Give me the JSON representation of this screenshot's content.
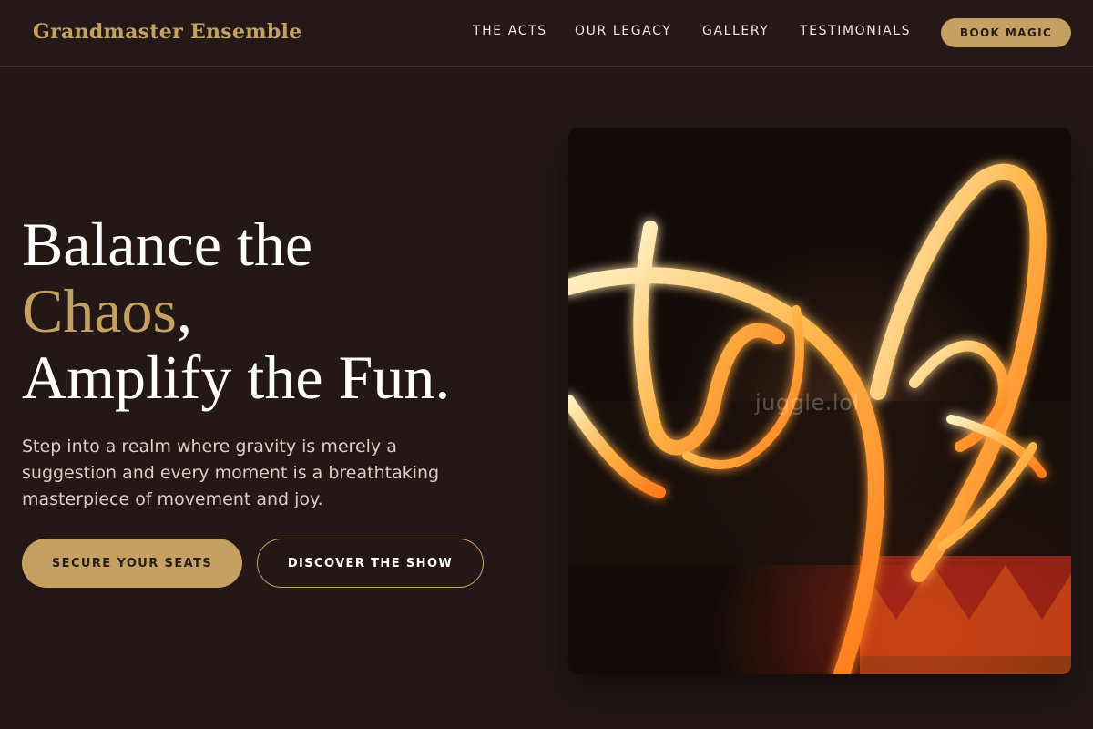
{
  "nav": {
    "brand": "Grandmaster Ensemble",
    "links": [
      {
        "label": "THE ACTS"
      },
      {
        "label": "OUR LEGACY"
      },
      {
        "label": "GALLERY"
      },
      {
        "label": "TESTIMONIALS"
      }
    ],
    "cta": "BOOK MAGIC"
  },
  "hero": {
    "headline_line1": "Balance the",
    "headline_accent": "Chaos",
    "headline_comma": ",",
    "headline_line3": "Amplify the Fun.",
    "subtext": "Step into a realm where gravity is merely a suggestion and every moment is a breathtaking masterpiece of movement and joy.",
    "primary_button": "SECURE YOUR SEATS",
    "secondary_button": "DISCOVER THE SHOW"
  },
  "image": {
    "watermark": "juggle.lol",
    "subject": "fire-juggling-performance"
  },
  "colors": {
    "background": "#231816",
    "accent": "#c4a062",
    "text": "#ffffff"
  }
}
